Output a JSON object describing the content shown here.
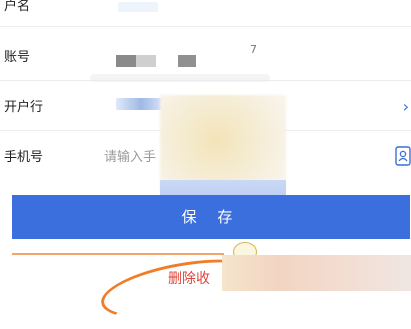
{
  "form": {
    "account_name_label": "户名",
    "account_number_label": "账号",
    "account_number_fragment": "7",
    "bank_label": "开户行",
    "phone_label": "手机号",
    "phone_placeholder": "请输入手",
    "chevron": "›"
  },
  "actions": {
    "save_label": "保 存",
    "delete_label": "删除收"
  },
  "colors": {
    "primary": "#3b6fdd",
    "danger": "#e0443a",
    "annotation": "#f07d2a"
  }
}
